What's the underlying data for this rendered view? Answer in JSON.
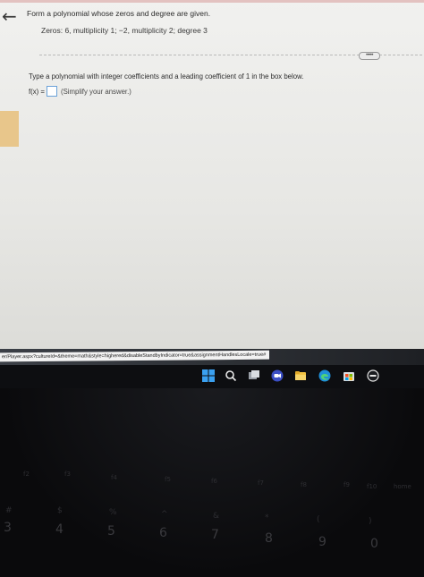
{
  "question": {
    "title": "Form a polynomial whose zeros and degree are given.",
    "zeros_line": "Zeros: 6, multiplicity 1;  −2, multiplicity 2;  degree 3",
    "more_label": "•••••",
    "instruction": "Type a polynomial with integer coefficients and a leading coefficient of 1 in the box below.",
    "answer_prefix": "f(x) =",
    "answer_value": "",
    "answer_hint": "(Simplify your answer.)"
  },
  "navigation": {
    "back_icon": "←"
  },
  "status_bar": {
    "url": "er/Player.aspx?cultureId=&theme=math&style=highered&disableStandbyIndicator=true&assignmentHandlesLocale=true#"
  },
  "taskbar": {
    "icons": [
      "windows-start-icon",
      "search-icon",
      "task-view-icon",
      "chat-icon",
      "file-explorer-icon",
      "edge-icon",
      "store-icon",
      "dell-icon"
    ]
  },
  "keyboard": {
    "number_keys": [
      "3",
      "4",
      "5",
      "6",
      "7",
      "8",
      "9",
      "0"
    ],
    "function_keys": [
      "f2",
      "f3",
      "f4",
      "f5",
      "f6",
      "f7",
      "f8",
      "f9",
      "f10",
      "home"
    ],
    "symbol_keys": [
      "#",
      "$",
      "%",
      "^",
      "&",
      "*",
      "(",
      ")"
    ]
  }
}
